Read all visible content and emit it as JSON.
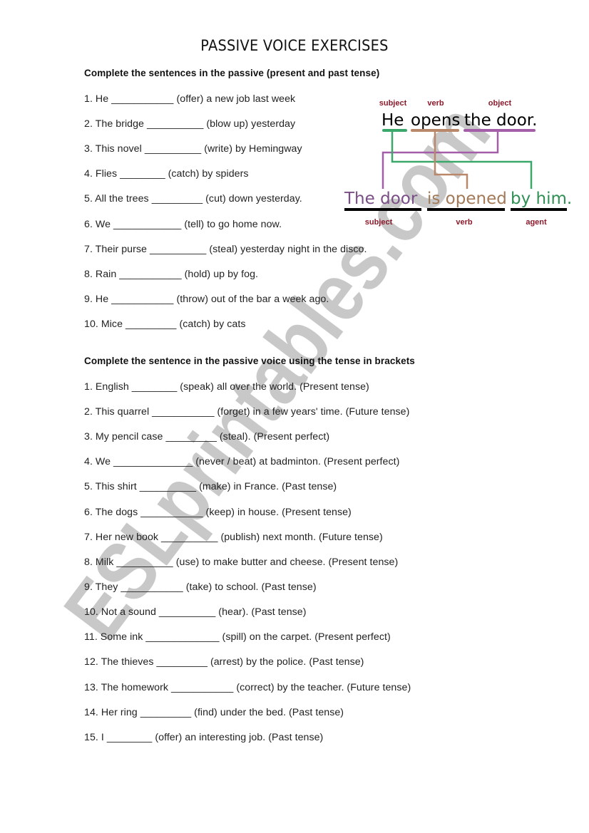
{
  "page": {
    "title": "PASSIVE VOICE EXERCISES",
    "watermark": "ESLprintables.com"
  },
  "section1": {
    "heading": "Complete the sentences in the passive (present and past tense)",
    "items": [
      "1. He ___________ (offer) a new job last week",
      "2. The bridge __________ (blow up) yesterday",
      "3. This novel __________ (write) by Hemingway",
      "4. Flies ________ (catch) by spiders",
      "5. All the trees _________ (cut) down yesterday.",
      "6. We ____________ (tell) to go home now.",
      "7. Their purse __________ (steal) yesterday night in the disco.",
      "8. Rain ___________ (hold) up by fog.",
      "9. He ___________ (throw) out of the bar a week ago.",
      "10. Mice _________ (catch) by cats"
    ]
  },
  "section2": {
    "heading": "Complete the sentence in the passive voice using the tense in brackets",
    "items": [
      "1. English ________ (speak) all over the world. (Present tense)",
      "2. This quarrel ___________ (forget) in a few years' time. (Future tense)",
      "3. My pencil case _________ (steal). (Present perfect)",
      "4. We ______________ (never / beat) at badminton. (Present perfect)",
      "5. This shirt __________ (make) in France. (Past tense)",
      "6. The dogs ___________ (keep) in house. (Present tense)",
      "7. Her new book __________ (publish) next month. (Future tense)",
      "8. Milk __________ (use) to make butter and cheese. (Present tense)",
      "9. They ___________ (take) to school. (Past tense)",
      "10. Not a sound __________ (hear). (Past tense)",
      "11. Some ink _____________ (spill) on the carpet. (Present perfect)",
      "12. The thieves _________ (arrest) by the police. (Past tense)",
      "13. The homework ___________ (correct) by the teacher. (Future tense)",
      "14. Her ring _________ (find) under the bed. (Past tense)",
      "15. I ________ (offer) an interesting job. (Past tense)"
    ]
  },
  "diagram": {
    "active": {
      "labels": {
        "subject": "subject",
        "verb": "verb",
        "object": "object"
      },
      "words": {
        "subject": "He",
        "verb": "opens",
        "object": "the door."
      }
    },
    "passive": {
      "words": {
        "subject": "The door",
        "verb": "is opened",
        "agent": "by him."
      },
      "labels": {
        "subject": "subject",
        "verb": "verb",
        "agent": "agent"
      }
    },
    "colors": {
      "label": "#8b1a2b",
      "subject_line": "#3aa86b",
      "verb_line": "#b9876a",
      "object_line": "#a45ea8",
      "passive_subject_text": "#7a4e86",
      "passive_verb_text": "#a27a58",
      "passive_agent_text": "#2f8f55",
      "underline": "#000000"
    }
  }
}
